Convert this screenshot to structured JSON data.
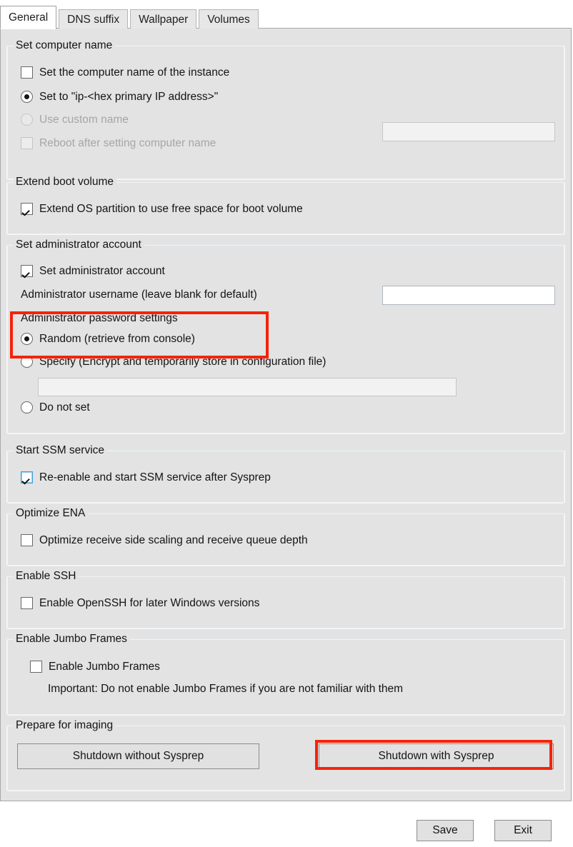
{
  "accent_red": "#f5230b",
  "tabs": [
    {
      "label": "General",
      "active": true
    },
    {
      "label": "DNS suffix",
      "active": false
    },
    {
      "label": "Wallpaper",
      "active": false
    },
    {
      "label": "Volumes",
      "active": false
    }
  ],
  "groups": {
    "computer_name": {
      "legend": "Set computer name",
      "set_name_checkbox": {
        "label": "Set the computer name of the instance",
        "checked": false,
        "enabled": true
      },
      "radio_ip_hex": {
        "label": "Set to \"ip-<hex primary IP address>\"",
        "selected": true,
        "enabled": true
      },
      "radio_custom": {
        "label": "Use custom name",
        "selected": false,
        "enabled": false
      },
      "custom_name_field": {
        "value": "",
        "placeholder": "",
        "enabled": false
      },
      "reboot_checkbox": {
        "label": "Reboot after setting computer name",
        "checked": false,
        "enabled": false
      }
    },
    "extend_boot": {
      "legend": "Extend boot volume",
      "extend_checkbox": {
        "label": "Extend OS partition to use free space for boot volume",
        "checked": true,
        "enabled": true
      }
    },
    "admin_account": {
      "legend": "Set administrator account",
      "set_admin_checkbox": {
        "label": "Set administrator account",
        "checked": true,
        "enabled": true
      },
      "username_label": "Administrator username (leave blank for default)",
      "username_field": {
        "value": "",
        "placeholder": "",
        "enabled": true
      },
      "password_settings_label": "Administrator password settings",
      "radio_random": {
        "label": "Random (retrieve from console)",
        "selected": true,
        "enabled": true
      },
      "radio_specify": {
        "label": "Specify (Encrypt and temporarily store in configuration file)",
        "selected": false,
        "enabled": true
      },
      "password_field": {
        "value": "",
        "placeholder": "",
        "enabled": false
      },
      "radio_donotset": {
        "label": "Do not set",
        "selected": false,
        "enabled": true
      }
    },
    "ssm": {
      "legend": "Start SSM service",
      "ssm_checkbox": {
        "label": "Re-enable and start SSM service after Sysprep",
        "checked": true,
        "enabled": true,
        "focused": true
      }
    },
    "ena": {
      "legend": "Optimize ENA",
      "ena_checkbox": {
        "label": "Optimize receive side scaling and receive queue depth",
        "checked": false,
        "enabled": true
      }
    },
    "ssh": {
      "legend": "Enable SSH",
      "ssh_checkbox": {
        "label": "Enable OpenSSH for later Windows versions",
        "checked": false,
        "enabled": true
      }
    },
    "jumbo": {
      "legend": "Enable Jumbo Frames",
      "jumbo_checkbox": {
        "label": "Enable Jumbo Frames",
        "checked": false,
        "enabled": true
      },
      "warning_text": "Important: Do not enable Jumbo Frames if you are not familiar with them"
    },
    "imaging": {
      "legend": "Prepare for imaging",
      "shutdown_without_sysprep": "Shutdown without Sysprep",
      "shutdown_with_sysprep": "Shutdown with Sysprep"
    }
  },
  "dialog_buttons": {
    "save": "Save",
    "exit": "Exit"
  },
  "annotations": [
    {
      "name": "highlight-password-settings",
      "target": "Administrator password settings / Random (retrieve from console)"
    },
    {
      "name": "highlight-shutdown-with-sysprep",
      "target": "Shutdown with Sysprep"
    }
  ]
}
